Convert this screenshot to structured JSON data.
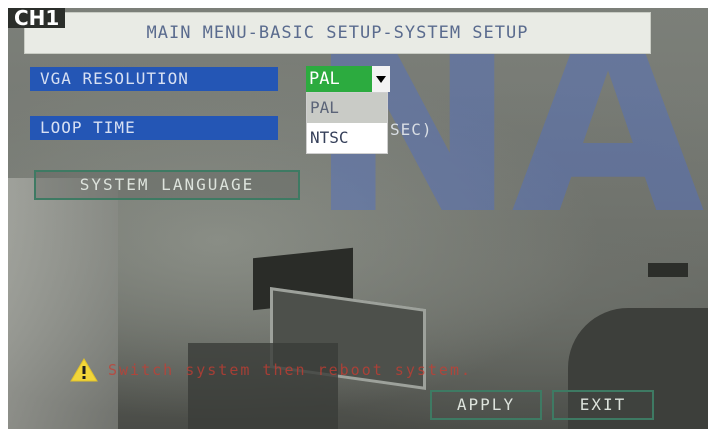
{
  "channel_label": "CH1",
  "title": "MAIN MENU-BASIC SETUP-SYSTEM SETUP",
  "settings": {
    "vga_resolution_label": "VGA RESOLUTION",
    "loop_time_label": "LOOP TIME",
    "loop_time_unit": "SEC)",
    "system_language_button": "SYSTEM LANGUAGE"
  },
  "dropdown": {
    "selected": "PAL",
    "options": [
      "PAL",
      "NTSC"
    ],
    "highlighted_option": "PAL"
  },
  "warning": {
    "icon": "warning-triangle-icon",
    "text": "Switch system then reboot system."
  },
  "buttons": {
    "apply": "APPLY",
    "exit": "EXIT"
  },
  "colors": {
    "label_background": "#2456B5",
    "selected_option": "#2CAB3F",
    "button_border": "#3E7A63",
    "warning_text": "#C83C32"
  }
}
